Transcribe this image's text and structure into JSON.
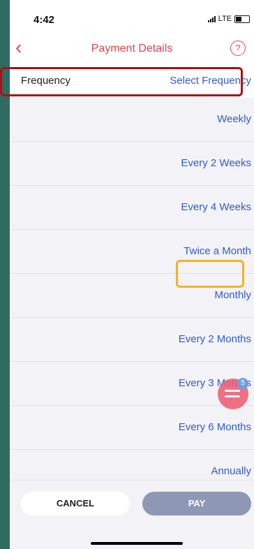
{
  "status": {
    "time": "4:42",
    "network": "LTE"
  },
  "nav": {
    "back_icon": "‹",
    "title": "Payment Details",
    "help_icon": "?"
  },
  "frequency": {
    "label": "Frequency",
    "value": "Select Frequency"
  },
  "options": [
    "Weekly",
    "Every 2 Weeks",
    "Every 4 Weeks",
    "Twice a Month",
    "Monthly",
    "Every 2 Months",
    "Every 3 Months",
    "Every 6 Months",
    "Annually"
  ],
  "chat": {
    "badge": "5",
    "icon": "chat-icon"
  },
  "footer": {
    "cancel": "CANCEL",
    "pay": "PAY"
  },
  "colors": {
    "accent": "#e2424f",
    "link": "#2f5bd0",
    "pay_button": "#8e98b4"
  }
}
